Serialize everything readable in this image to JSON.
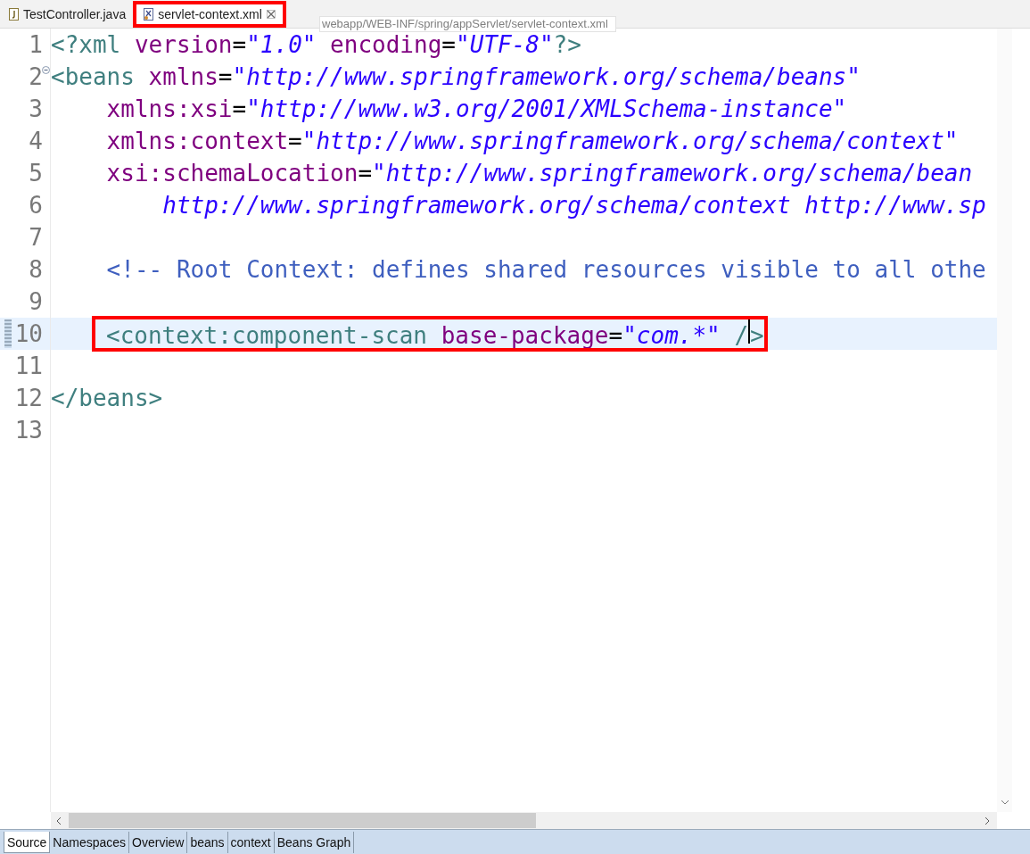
{
  "editor_tabs": [
    {
      "label": "TestController.java",
      "kind": "java",
      "selected": false,
      "closable": false,
      "outlined": false
    },
    {
      "label": "servlet-context.xml",
      "kind": "xml",
      "selected": true,
      "closable": true,
      "outlined": true
    }
  ],
  "tooltip": "webapp/WEB-INF/spring/appServlet/servlet-context.xml",
  "code_lines": [
    {
      "number": "1",
      "fold": false,
      "current": false,
      "outlined": false,
      "tokens": [
        {
          "kind": "tag",
          "text": "<?xml"
        },
        {
          "kind": "attr",
          "text": " version"
        },
        {
          "kind": "eq",
          "text": "="
        },
        {
          "kind": "value",
          "text": "\"1.0\""
        },
        {
          "kind": "attr",
          "text": " encoding"
        },
        {
          "kind": "eq",
          "text": "="
        },
        {
          "kind": "value",
          "text": "\"UTF-8\""
        },
        {
          "kind": "tag",
          "text": "?>"
        }
      ]
    },
    {
      "number": "2",
      "fold": true,
      "current": false,
      "outlined": false,
      "tokens": [
        {
          "kind": "tag",
          "text": "<beans"
        },
        {
          "kind": "attr",
          "text": " xmlns"
        },
        {
          "kind": "eq",
          "text": "="
        },
        {
          "kind": "value",
          "text": "\"http://www.springframework.org/schema/beans\""
        }
      ]
    },
    {
      "number": "3",
      "fold": false,
      "current": false,
      "outlined": false,
      "tokens": [
        {
          "kind": "attr",
          "text": "    xmlns:xsi"
        },
        {
          "kind": "eq",
          "text": "="
        },
        {
          "kind": "value",
          "text": "\"http://www.w3.org/2001/XMLSchema-instance\""
        }
      ]
    },
    {
      "number": "4",
      "fold": false,
      "current": false,
      "outlined": false,
      "tokens": [
        {
          "kind": "attr",
          "text": "    xmlns:context"
        },
        {
          "kind": "eq",
          "text": "="
        },
        {
          "kind": "value",
          "text": "\"http://www.springframework.org/schema/context\""
        }
      ]
    },
    {
      "number": "5",
      "fold": false,
      "current": false,
      "outlined": false,
      "tokens": [
        {
          "kind": "attr",
          "text": "    xsi:schemaLocation"
        },
        {
          "kind": "eq",
          "text": "="
        },
        {
          "kind": "value",
          "text": "\"http://www.springframework.org/schema/bean"
        }
      ]
    },
    {
      "number": "6",
      "fold": false,
      "current": false,
      "outlined": false,
      "tokens": [
        {
          "kind": "value",
          "text": "        http://www.springframework.org/schema/context http://www.sp"
        }
      ]
    },
    {
      "number": "7",
      "fold": false,
      "current": false,
      "outlined": false
    },
    {
      "number": "8",
      "fold": false,
      "current": false,
      "outlined": false,
      "tokens": [
        {
          "kind": "comment",
          "text": "    <!-- Root Context: defines shared resources visible to all othe"
        }
      ]
    },
    {
      "number": "9",
      "fold": false,
      "current": false,
      "outlined": false
    },
    {
      "number": "10",
      "fold": false,
      "current": true,
      "outlined": true,
      "tokens": [
        {
          "kind": "tag",
          "text": "<context:component-scan"
        },
        {
          "kind": "attr",
          "text": " base-package"
        },
        {
          "kind": "eq",
          "text": "="
        },
        {
          "kind": "value",
          "text": "\"com.*\""
        },
        {
          "kind": "tag",
          "text": " /"
        },
        {
          "kind": "caret"
        },
        {
          "kind": "tag",
          "text": ">"
        }
      ]
    },
    {
      "number": "11",
      "fold": false,
      "current": false,
      "outlined": false
    },
    {
      "number": "12",
      "fold": false,
      "current": false,
      "outlined": false,
      "tokens": [
        {
          "kind": "tag",
          "text": "</beans>"
        }
      ]
    },
    {
      "number": "13",
      "fold": false,
      "current": false,
      "outlined": false
    }
  ],
  "page_tabs": [
    {
      "label": "Source",
      "selected": true
    },
    {
      "label": "Namespaces",
      "selected": false
    },
    {
      "label": "Overview",
      "selected": false
    },
    {
      "label": "beans",
      "selected": false
    },
    {
      "label": "context",
      "selected": false
    },
    {
      "label": "Beans Graph",
      "selected": false
    }
  ]
}
